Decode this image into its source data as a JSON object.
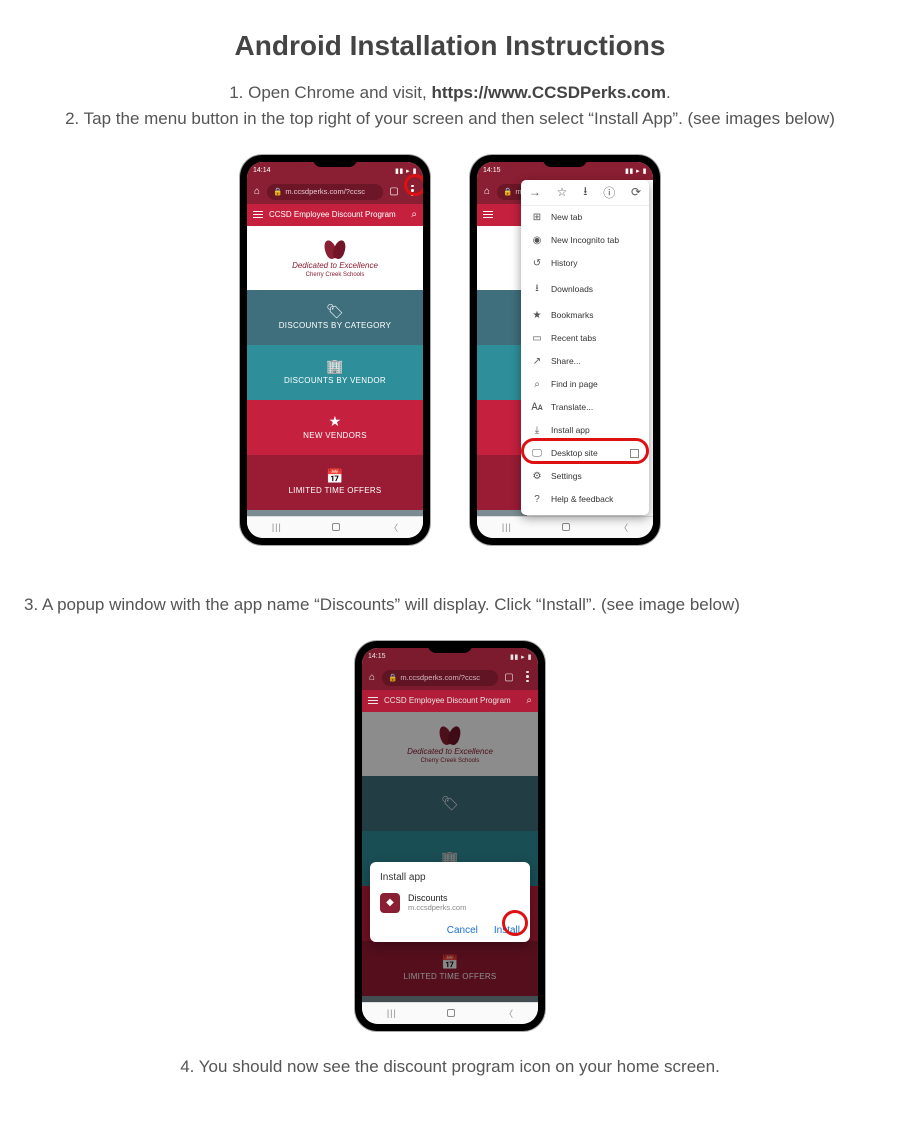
{
  "title": "Android Installation Instructions",
  "steps": {
    "s1_prefix": "1. Open Chrome and visit, ",
    "s1_url": "https://www.CCSDPerks.com",
    "s1_suffix": ".",
    "s2": "2. Tap the menu button in the top right of your screen and then select “Install App”.  (see images below)",
    "s3": "3. A popup window with the app name “Discounts” will display. Click “Install”. (see image below)",
    "s4": "4. You should now see the discount program icon on your home screen."
  },
  "phone": {
    "time1": "14:14",
    "time2": "14:15",
    "url": "m.ccsdperks.com/?ccsc",
    "brand_line1": "Dedicated to Excellence",
    "brand_line2": "Cherry Creek Schools",
    "header_title": "CCSD Employee Discount Program",
    "tiles": {
      "cat": "DISCOUNTS BY CATEGORY",
      "vend": "DISCOUNTS BY VENDOR",
      "new": "NEW VENDORS",
      "limit": "LIMITED TIME OFFERS"
    }
  },
  "chrome_menu": {
    "new_tab": "New tab",
    "incognito": "New Incognito tab",
    "history": "History",
    "downloads": "Downloads",
    "bookmarks": "Bookmarks",
    "recent": "Recent tabs",
    "share": "Share...",
    "find": "Find in page",
    "translate": "Translate...",
    "install": "Install app",
    "desktop": "Desktop site",
    "settings": "Settings",
    "help": "Help & feedback"
  },
  "dialog": {
    "title": "Install app",
    "app_name": "Discounts",
    "app_host": "m.ccsdperks.com",
    "cancel": "Cancel",
    "install": "Install"
  }
}
